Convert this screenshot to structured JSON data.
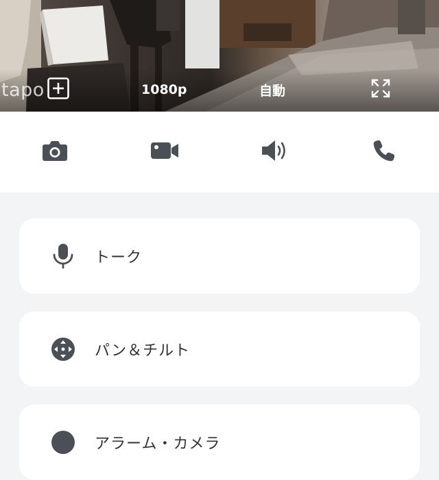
{
  "feed": {
    "watermark": "tapo",
    "resolution": "1080p",
    "mode": "自動",
    "icons": {
      "add": "plus-square-icon",
      "fullscreen": "fullscreen-icon"
    }
  },
  "actions": [
    {
      "icon": "camera-icon"
    },
    {
      "icon": "video-record-icon"
    },
    {
      "icon": "speaker-icon"
    },
    {
      "icon": "phone-icon"
    }
  ],
  "menu": {
    "talk_label": "トーク",
    "pan_tilt_label": "パン＆チルト",
    "third_label": "アラーム・カメラ"
  },
  "colors": {
    "icon": "#4a5056",
    "background": "#f3f4f6",
    "card": "#ffffff"
  }
}
